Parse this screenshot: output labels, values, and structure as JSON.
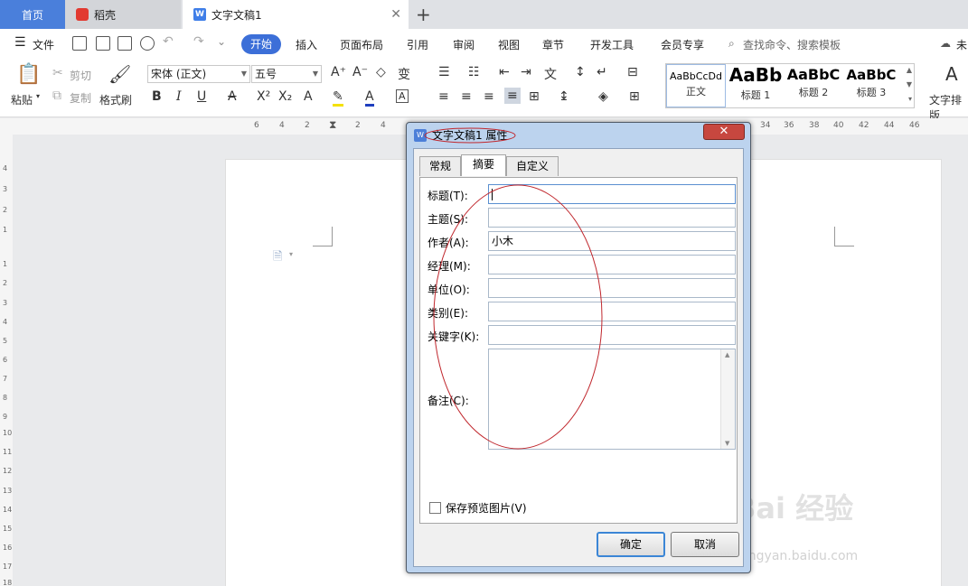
{
  "tabs": {
    "home": "首页",
    "daoke": "稻壳",
    "document": "文字文稿1"
  },
  "menu": {
    "file": "文件",
    "items": [
      "开始",
      "插入",
      "页面布局",
      "引用",
      "审阅",
      "视图",
      "章节",
      "开发工具",
      "会员专享"
    ],
    "search_placeholder": "查找命令、搜索模板",
    "right_partial": "未"
  },
  "ribbon": {
    "paste": "粘贴",
    "cut": "剪切",
    "copy": "复制",
    "format_painter": "格式刷",
    "font_name": "宋体 (正文)",
    "font_size": "五号",
    "styles": [
      {
        "sample": "AaBbCcDd",
        "name": "正文"
      },
      {
        "sample": "AaBb",
        "name": "标题 1"
      },
      {
        "sample": "AaBbC",
        "name": "标题 2"
      },
      {
        "sample": "AaBbC",
        "name": "标题 3"
      }
    ],
    "text_layout": "文字排版"
  },
  "ruler": {
    "top_left": [
      "6",
      "4",
      "2",
      "2",
      "4"
    ],
    "top_right": [
      "34",
      "36",
      "38",
      "40",
      "42",
      "44",
      "46"
    ],
    "left": [
      "4",
      "3",
      "2",
      "1",
      "1",
      "2",
      "3",
      "4",
      "5",
      "6",
      "7",
      "8",
      "9",
      "10",
      "11",
      "12",
      "13",
      "14",
      "15",
      "16",
      "17",
      "18"
    ]
  },
  "dialog": {
    "title": "文字文稿1 属性",
    "close": "✕",
    "tabs": [
      "常规",
      "摘要",
      "自定义"
    ],
    "fields": [
      {
        "label": "标题(T):",
        "value": ""
      },
      {
        "label": "主题(S):",
        "value": ""
      },
      {
        "label": "作者(A):",
        "value": "小木"
      },
      {
        "label": "经理(M):",
        "value": ""
      },
      {
        "label": "单位(O):",
        "value": ""
      },
      {
        "label": "类别(E):",
        "value": ""
      },
      {
        "label": "关键字(K):",
        "value": ""
      }
    ],
    "notes_label": "备注(C):",
    "save_preview_label": "保存预览图片(V)",
    "ok": "确定",
    "cancel": "取消"
  },
  "watermark": {
    "main": "Bai 经验",
    "sub": "jingyan.baidu.com"
  },
  "colors": {
    "accent": "#3c6fd8",
    "dialog_frame": "#bcd3ee",
    "annotation": "#c0272d"
  }
}
